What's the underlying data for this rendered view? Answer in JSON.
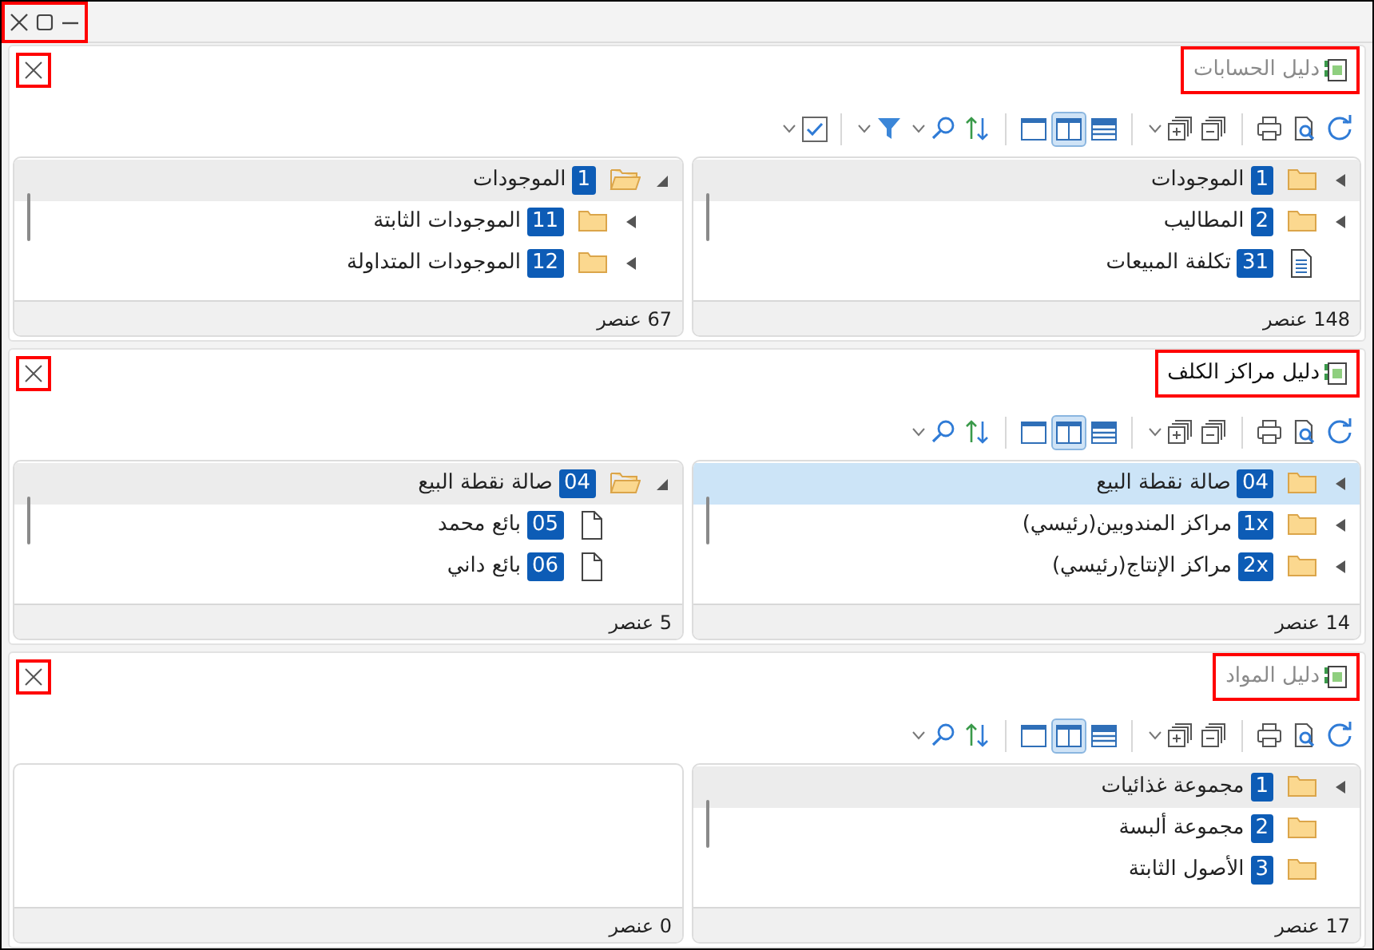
{
  "window": {
    "controls_highlighted": true
  },
  "panels": [
    {
      "title": "دليل الحسابات",
      "active": false,
      "title_highlighted": true,
      "close_highlighted": true,
      "tools": [
        {
          "kind": "refresh",
          "dropdown": false
        },
        {
          "kind": "preview",
          "dropdown": false
        },
        {
          "kind": "print",
          "dropdown": false
        },
        {
          "kind": "separator"
        },
        {
          "kind": "collapse",
          "dropdown": false
        },
        {
          "kind": "expand",
          "dropdown": true
        },
        {
          "kind": "separator"
        },
        {
          "kind": "layout_rows",
          "selected": false,
          "dropdown": false
        },
        {
          "kind": "layout_split",
          "selected": true,
          "dropdown": false
        },
        {
          "kind": "layout_single",
          "selected": false,
          "dropdown": false
        },
        {
          "kind": "separator"
        },
        {
          "kind": "sort",
          "dropdown": false
        },
        {
          "kind": "search",
          "dropdown": true
        },
        {
          "kind": "filter",
          "dropdown": true
        },
        {
          "kind": "separator"
        },
        {
          "kind": "check",
          "dropdown": true
        }
      ],
      "panes": [
        {
          "count": "148 عنصر",
          "rows": [
            {
              "code": "1",
              "label": "الموجودات",
              "kind": "folder",
              "expanded": false,
              "selected": false,
              "hovered": true
            },
            {
              "code": "2",
              "label": "المطاليب",
              "kind": "folder",
              "expanded": false,
              "selected": false,
              "hovered": false
            },
            {
              "code": "31",
              "label": "تكلفة المبيعات",
              "kind": "document",
              "selected": false,
              "hovered": false
            }
          ]
        },
        {
          "count": "67 عنصر",
          "rows": [
            {
              "code": "1",
              "label": "الموجودات",
              "kind": "folder",
              "expanded": true,
              "selected": false,
              "hovered": true,
              "children": [
                {
                  "code": "11",
                  "label": "الموجودات الثابتة",
                  "kind": "folder",
                  "expanded": false,
                  "selected": false,
                  "hovered": false
                },
                {
                  "code": "12",
                  "label": "الموجودات المتداولة",
                  "kind": "folder",
                  "expanded": false,
                  "selected": false,
                  "hovered": false
                }
              ]
            }
          ]
        }
      ]
    },
    {
      "title": "دليل مراكز الكلف",
      "active": true,
      "title_highlighted": true,
      "close_highlighted": true,
      "tools": [
        {
          "kind": "refresh",
          "dropdown": false
        },
        {
          "kind": "preview",
          "dropdown": false
        },
        {
          "kind": "print",
          "dropdown": false
        },
        {
          "kind": "separator"
        },
        {
          "kind": "collapse",
          "dropdown": false
        },
        {
          "kind": "expand",
          "dropdown": true
        },
        {
          "kind": "separator"
        },
        {
          "kind": "layout_rows",
          "selected": false,
          "dropdown": false
        },
        {
          "kind": "layout_split",
          "selected": true,
          "dropdown": false
        },
        {
          "kind": "layout_single",
          "selected": false,
          "dropdown": false
        },
        {
          "kind": "separator"
        },
        {
          "kind": "sort",
          "dropdown": false
        },
        {
          "kind": "search",
          "dropdown": true
        }
      ],
      "panes": [
        {
          "count": "14 عنصر",
          "rows": [
            {
              "code": "04",
              "label": "صالة نقطة البيع",
              "kind": "folder",
              "expanded": false,
              "selected": true,
              "hovered": false
            },
            {
              "code": "1x",
              "label": "مراكز المندوبين(رئيسي)",
              "kind": "folder",
              "expanded": false,
              "selected": false,
              "hovered": false
            },
            {
              "code": "2x",
              "label": "مراكز الإنتاج(رئيسي)",
              "kind": "folder",
              "expanded": false,
              "selected": false,
              "hovered": false
            }
          ]
        },
        {
          "count": "5 عنصر",
          "rows": [
            {
              "code": "04",
              "label": "صالة نقطة البيع",
              "kind": "folder",
              "expanded": true,
              "selected": false,
              "hovered": true,
              "children": [
                {
                  "code": "05",
                  "label": "بائع محمد",
                  "kind": "page",
                  "selected": false,
                  "hovered": false
                },
                {
                  "code": "06",
                  "label": "بائع داني",
                  "kind": "page",
                  "selected": false,
                  "hovered": false
                }
              ]
            }
          ]
        }
      ]
    },
    {
      "title": "دليل المواد",
      "active": false,
      "title_highlighted": true,
      "close_highlighted": true,
      "tools": [
        {
          "kind": "refresh",
          "dropdown": false
        },
        {
          "kind": "preview",
          "dropdown": false
        },
        {
          "kind": "print",
          "dropdown": false
        },
        {
          "kind": "separator"
        },
        {
          "kind": "collapse",
          "dropdown": false
        },
        {
          "kind": "expand",
          "dropdown": true
        },
        {
          "kind": "separator"
        },
        {
          "kind": "layout_rows",
          "selected": false,
          "dropdown": false
        },
        {
          "kind": "layout_split",
          "selected": true,
          "dropdown": false
        },
        {
          "kind": "layout_single",
          "selected": false,
          "dropdown": false
        },
        {
          "kind": "separator"
        },
        {
          "kind": "sort",
          "dropdown": false
        },
        {
          "kind": "search",
          "dropdown": true
        }
      ],
      "panes": [
        {
          "count": "17 عنصر",
          "rows": [
            {
              "code": "1",
              "label": "مجموعة غذائيات",
              "kind": "folder",
              "expanded": false,
              "selected": false,
              "hovered": true
            },
            {
              "code": "2",
              "label": "مجموعة ألبسة",
              "kind": "folder",
              "selected": false,
              "hovered": false
            },
            {
              "code": "3",
              "label": "الأصول الثابتة",
              "kind": "folder",
              "selected": false,
              "hovered": false
            }
          ]
        },
        {
          "count": "0 عنصر"
        }
      ]
    }
  ]
}
